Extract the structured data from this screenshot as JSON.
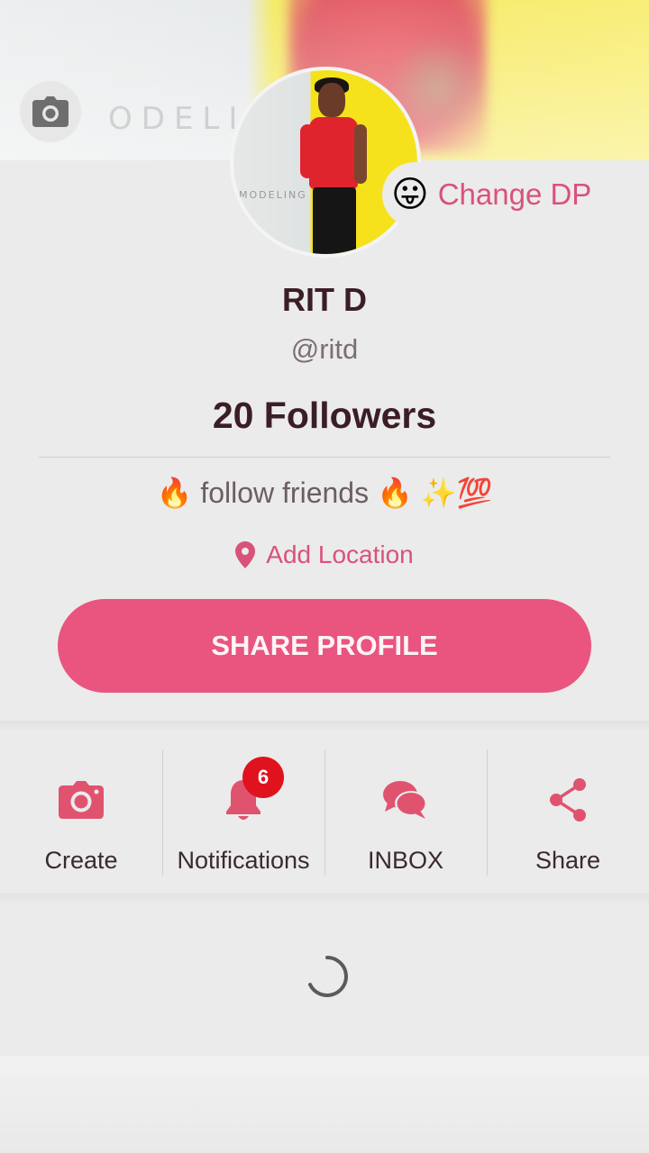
{
  "profile": {
    "name": "RIT D",
    "handle": "@ritd",
    "followers_text": "20 Followers",
    "bio": "🔥 follow friends 🔥 ✨💯",
    "location_label": "Add Location",
    "change_dp_label": "Change DP",
    "change_dp_emoji": "😛",
    "avatar_watermark": "MODELING",
    "cover_watermark": "ODELIN"
  },
  "share_profile_label": "SHARE PROFILE",
  "actions": [
    {
      "label": "Create",
      "icon": "camera-icon"
    },
    {
      "label": "Notifications",
      "icon": "bell-icon",
      "badge": "6"
    },
    {
      "label": "INBOX",
      "icon": "chat-bubbles-icon"
    },
    {
      "label": "Share",
      "icon": "share-icon"
    }
  ],
  "colors": {
    "accent": "#e9557f",
    "accent_text": "#d9527a",
    "title_text": "#3b1e25",
    "badge": "#e0121e"
  }
}
